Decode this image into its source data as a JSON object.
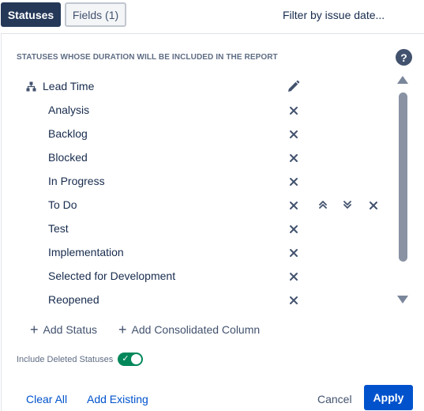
{
  "tabs": {
    "statuses": "Statuses",
    "fields": "Fields (1)"
  },
  "filter_label": "Filter by issue date...",
  "section_title": "STATUSES WHOSE DURATION WILL BE INCLUDED IN THE REPORT",
  "help_icon": "?",
  "group": {
    "label": "Lead Time",
    "icon": "hierarchy-icon"
  },
  "statuses": [
    "Analysis",
    "Backlog",
    "Blocked",
    "In Progress",
    "To Do",
    "Test",
    "Implementation",
    "Selected for Development",
    "Reopened"
  ],
  "actions": {
    "add_status": "Add Status",
    "add_consolidated": "Add Consolidated Column"
  },
  "include_deleted": {
    "label": "Include Deleted Statuses",
    "enabled": true
  },
  "footer": {
    "clear_all": "Clear All",
    "add_existing": "Add Existing",
    "cancel": "Cancel",
    "apply": "Apply"
  },
  "colors": {
    "primary": "#0052cc",
    "dark_tab": "#253858",
    "toggle_on": "#00875a"
  }
}
